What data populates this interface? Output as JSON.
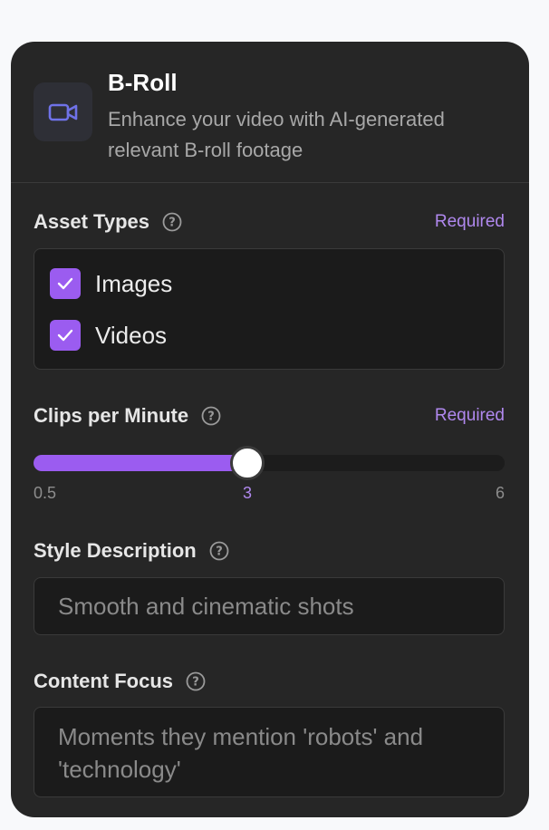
{
  "header": {
    "icon": "video-camera-icon",
    "title": "B-Roll",
    "description": "Enhance your video with AI-generated relevant B-roll footage"
  },
  "asset_types": {
    "label": "Asset Types",
    "required": "Required",
    "options": [
      {
        "label": "Images",
        "checked": true
      },
      {
        "label": "Videos",
        "checked": true
      }
    ]
  },
  "clips_per_minute": {
    "label": "Clips per Minute",
    "required": "Required",
    "min_label": "0.5",
    "value_label": "3",
    "max_label": "6",
    "min": 0.5,
    "max": 6,
    "value": 3
  },
  "style_description": {
    "label": "Style Description",
    "placeholder": "Smooth and cinematic shots"
  },
  "content_focus": {
    "label": "Content Focus",
    "placeholder": "Moments they mention 'robots' and 'technology'"
  },
  "colors": {
    "accent": "#9b5cf0",
    "card": "#262626",
    "required": "#b088ee"
  }
}
